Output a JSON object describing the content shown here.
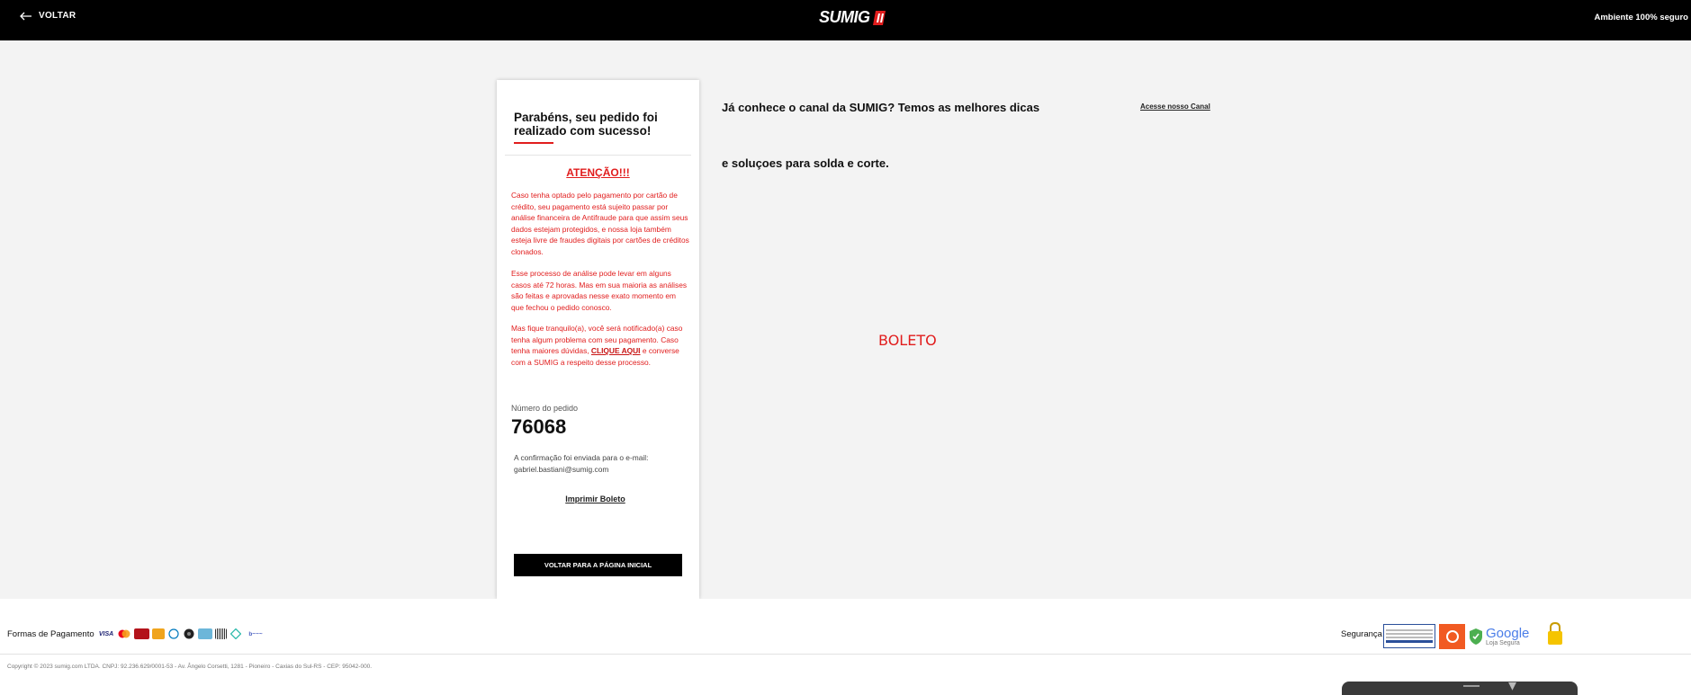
{
  "header": {
    "back_label": "VOLTAR",
    "logo_text": "SUMIG",
    "secure_text": "Ambiente 100% seguro"
  },
  "card": {
    "title": "Parabéns, seu pedido foi realizado com sucesso!",
    "attention": "ATENÇÃO!!!",
    "paragraph_1": "Caso tenha optado pelo pagamento por cartão de crédito, seu pagamento está sujeito passar por análise financeira de Antifraude para que assim seus dados estejam protegidos, e nossa loja também esteja livre de fraudes digitais por cartões de créditos clonados.",
    "paragraph_2": "Esse processo de análise pode levar em alguns casos até 72 horas. Mas em sua maioria as análises são feitas e aprovadas nesse exato momento em que fechou o pedido conosco.",
    "paragraph_3_before": "Mas fique tranquilo(a), você será notificado(a) caso tenha algum problema com seu pagamento. Caso tenha maiores dúvidas, ",
    "paragraph_3_link": "CLIQUE AQUI",
    "paragraph_3_after": " e converse com a SUMIG a respeito desse processo.",
    "order_label": "Número do pedido",
    "order_number": "76068",
    "confirmation_text": "A confirmação foi enviada para o e-mail:",
    "confirmation_email": "gabriel.bastiani@sumig.com",
    "print_link": "Imprimir Boleto",
    "home_button": "VOLTAR PARA A PÁGINA INICIAL"
  },
  "canal": {
    "line_1": "Já conhece o canal da SUMIG? Temos as melhores dicas",
    "line_2": "e soluçoes para solda e corte.",
    "link": "Acesse nosso Canal"
  },
  "boleto_label": "BOLETO",
  "footer": {
    "payments_label": "Formas de Pagamento",
    "payment_icons": [
      "visa-icon",
      "mastercard-icon",
      "hipercard-icon",
      "elo-icon",
      "diners-icon",
      "amex-icon",
      "jcb-icon",
      "boleto-icon",
      "pix-icon",
      "bank-transfer-icon"
    ],
    "security_label": "Segurança",
    "security_icons": [
      "alphassl-badge-icon",
      "sitelock-badge-icon",
      "google-safe-browsing-icon",
      "https-lock-icon"
    ],
    "google_text": "Google",
    "google_subtext": "Loja Segura",
    "copyright": "Copyright © 2023 sumig.com LTDA. CNPJ: 92.236.629/0001-53 - Av. Ângelo Corsetti, 1281 - Pioneiro - Caxias do Sul-RS - CEP: 95042-000."
  },
  "colors": {
    "accent_red": "#e11d1d",
    "header_bg": "#000000",
    "page_bg": "#f3f3f3"
  }
}
